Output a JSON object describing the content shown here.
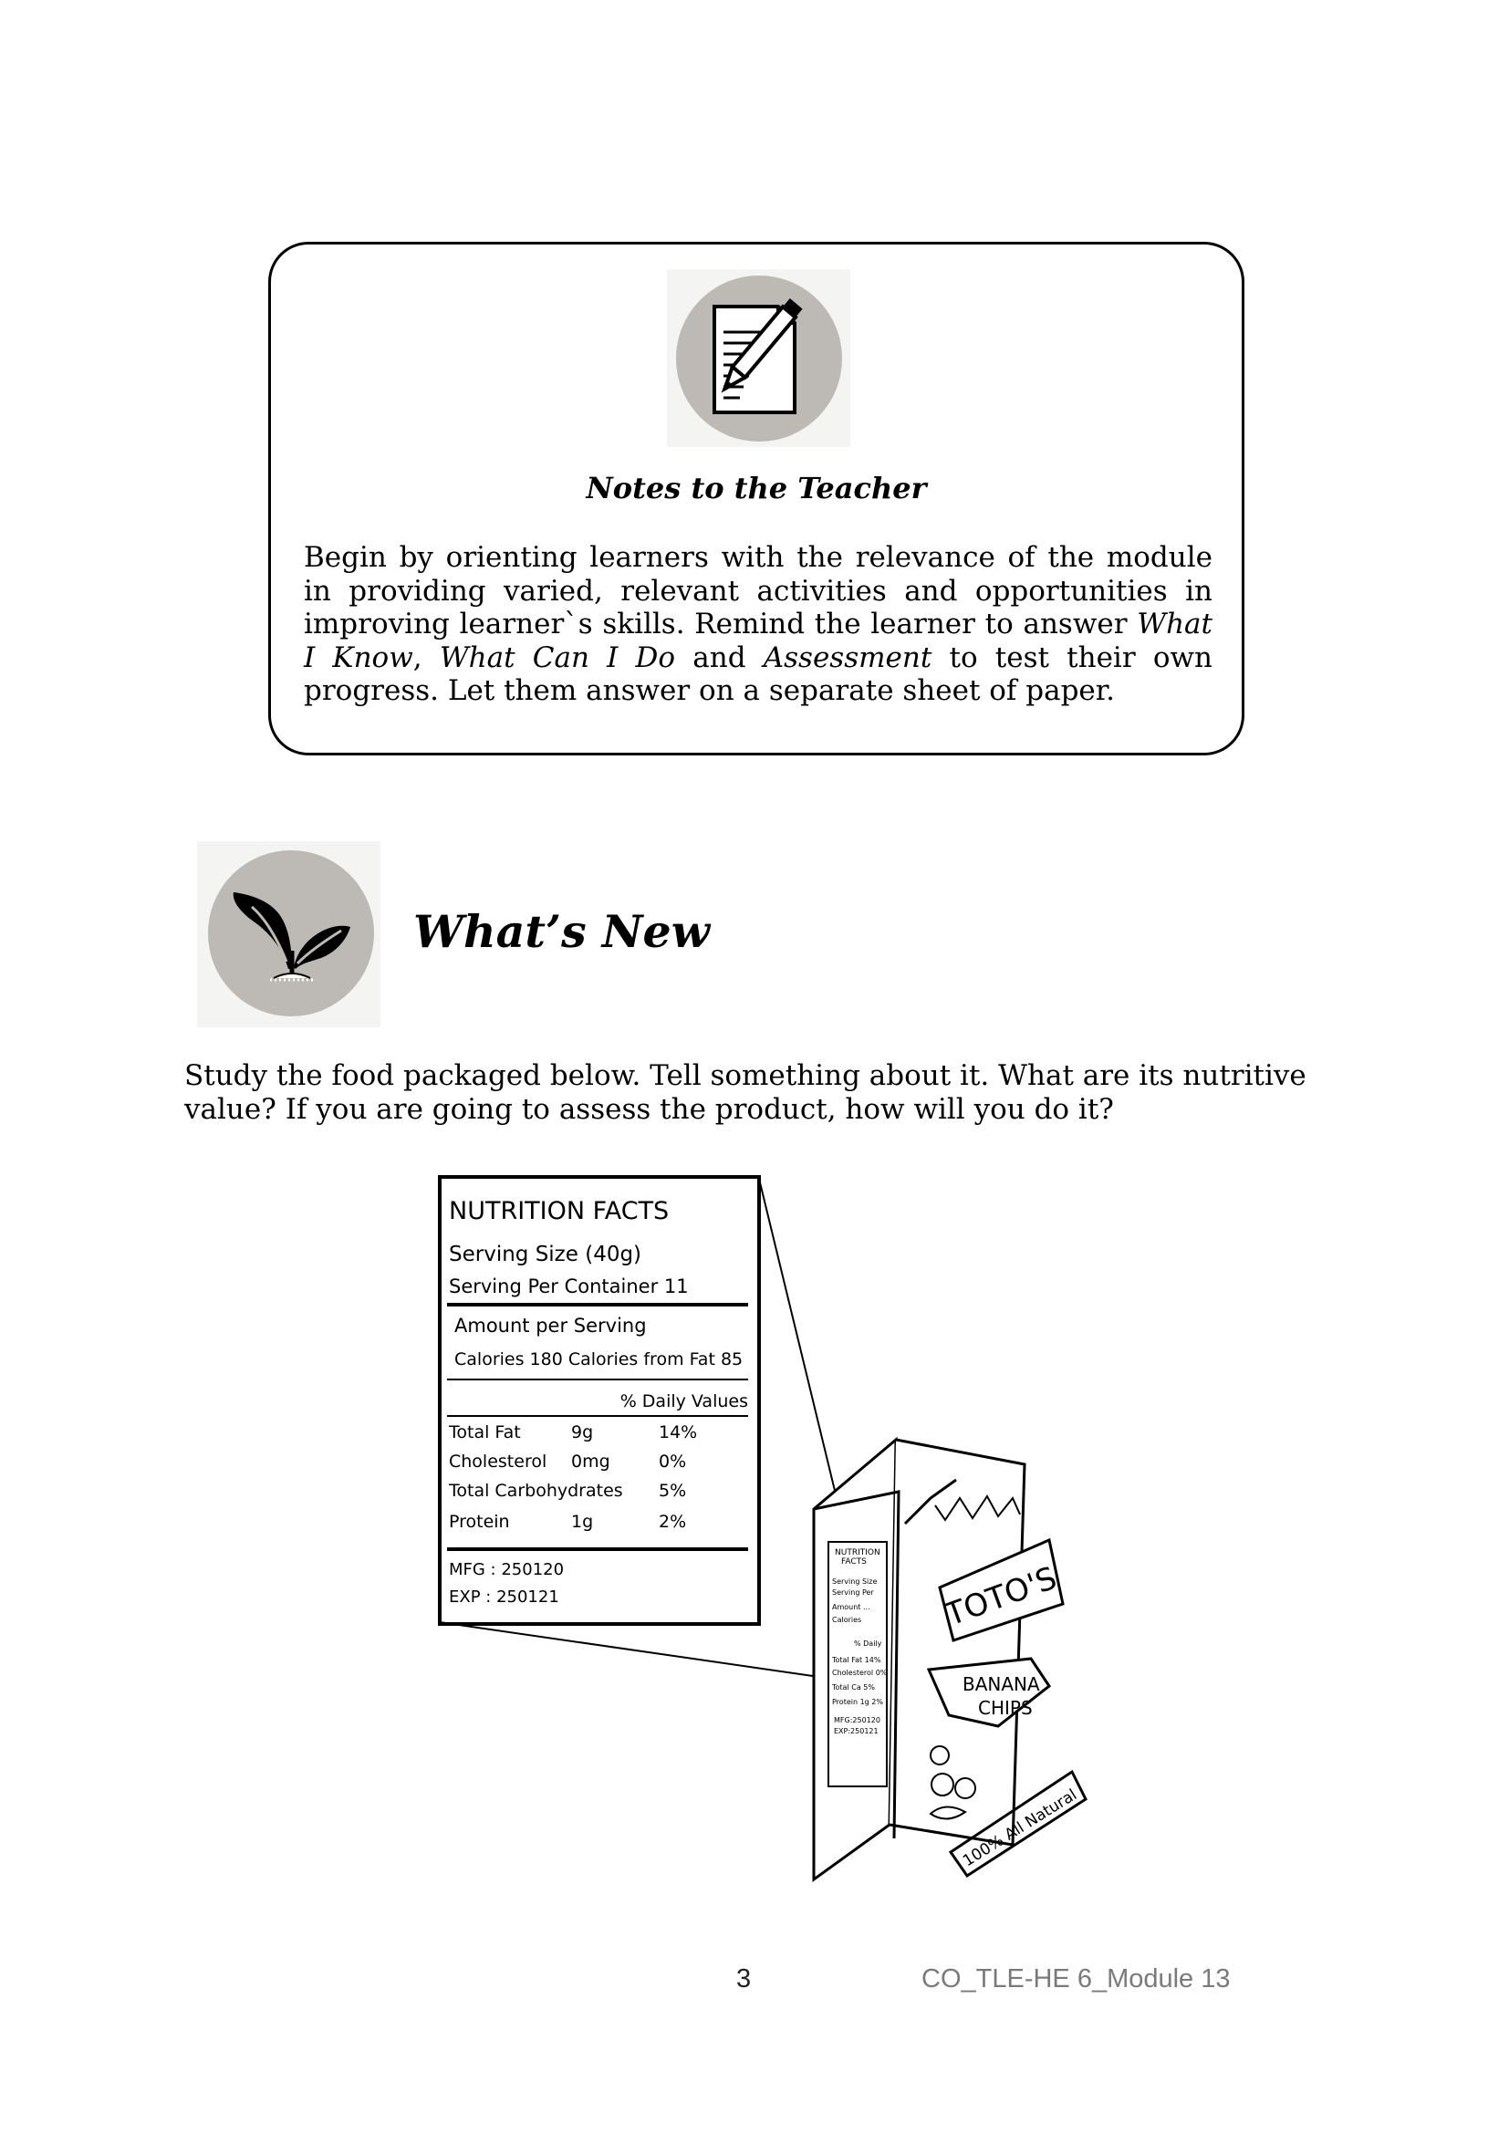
{
  "notes": {
    "icon": "document-pencil-icon",
    "title": "Notes to the Teacher",
    "body": {
      "p1": "Begin by orienting learners with the relevance of the module in providing varied, relevant activities and opportunities in improving learner`s skills. Remind the learner to answer ",
      "what_i_know": "What I Know",
      "sep1": ", ",
      "what_can_i_do": "What Can I Do",
      "sep2": " and ",
      "assessment": "Assessment",
      "p2": " to test their own progress. Let them answer on a separate sheet of paper."
    }
  },
  "whats_new": {
    "icon": "sprout-icon",
    "title": "What’s New",
    "instruction": "Study the food packaged below. Tell something about it. What are its nutritive value? If you are going to assess the product, how will you do it?"
  },
  "label": {
    "title": "NUTRITION FACTS",
    "serving_size": "Serving Size (40g)",
    "serving_per_container": "Serving Per Container 11",
    "amount_per_serving": "Amount per Serving",
    "calories": "Calories 180 Calories from Fat 85",
    "daily_values": "% Daily Values",
    "rows": [
      {
        "name": "Total Fat",
        "amount": "9g",
        "pct": "14%"
      },
      {
        "name": "Cholesterol",
        "amount": "0mg",
        "pct": "0%"
      },
      {
        "name": "Total Carbohydrates",
        "amount": "",
        "pct": "5%"
      },
      {
        "name": "Protein",
        "amount": "1g",
        "pct": "2%"
      }
    ],
    "mfg": "MFG : 250120",
    "exp": "EXP : 250121"
  },
  "package": {
    "brand": "TOTO'S",
    "product_line1": "BANANA",
    "product_line2": "CHIPS",
    "tagline": "100% All Natural",
    "small_label": {
      "title1": "NUTRITION",
      "title2": "FACTS",
      "lines": [
        "Serving Size",
        "Serving Per",
        "Amount ...",
        "Calories",
        "% Daily",
        "Total Fat 14%",
        "Cholesterol 0%",
        "Total Ca 5%",
        "Protein 1g 2%",
        "MFG:250120",
        "EXP:250121"
      ]
    }
  },
  "footer": {
    "page_number": "3",
    "code": "CO_TLE-HE 6_Module 13"
  }
}
